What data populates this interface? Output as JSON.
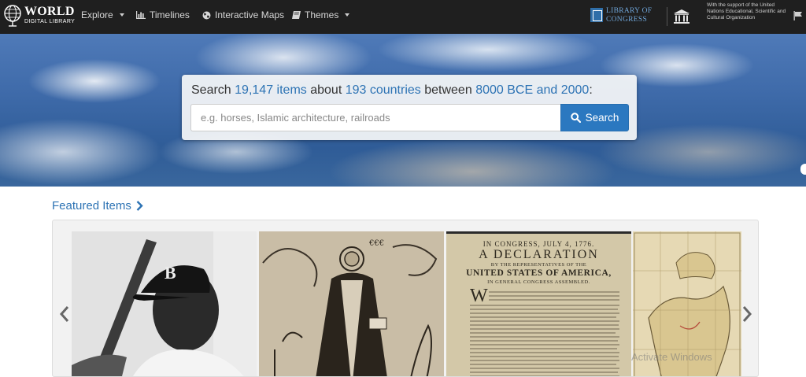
{
  "brand": {
    "line1": "WORLD",
    "line2": "DIGITAL LIBRARY"
  },
  "nav": {
    "explore": "Explore",
    "timelines": "Timelines",
    "maps": "Interactive Maps",
    "themes": "Themes"
  },
  "partners": {
    "loc_line1": "LIBRARY OF",
    "loc_line2": "CONGRESS",
    "unesco_text": "With the support of the United Nations Educational, Scientific and Cultural Organization"
  },
  "hero": {
    "search_prefix": "Search",
    "item_count": "19,147 items",
    "about": "about",
    "country_count": "193 countries",
    "between": "between",
    "date_range": "8000 BCE and 2000",
    "colon": ":",
    "placeholder": "e.g. horses, Islamic architecture, railroads",
    "button": "Search"
  },
  "featured": {
    "title": "Featured Items",
    "items": [
      {
        "kind": "photo",
        "subject": "Baseball player"
      },
      {
        "kind": "engraving",
        "subject": "Saint figure woodcut"
      },
      {
        "kind": "document",
        "line1": "IN CONGRESS, JULY 4, 1776.",
        "line2": "A DECLARATION",
        "line3": "BY THE REPRESENTATIVES OF THE",
        "line4": "UNITED STATES OF AMERICA,",
        "line5": "IN GENERAL CONGRESS ASSEMBLED."
      },
      {
        "kind": "map",
        "subject": "Map of Africa"
      }
    ]
  },
  "watermark": "Activate Windows",
  "colors": {
    "nav_bg": "#1f1f1f",
    "accent": "#2b78c0",
    "link": "#2d73b4"
  }
}
